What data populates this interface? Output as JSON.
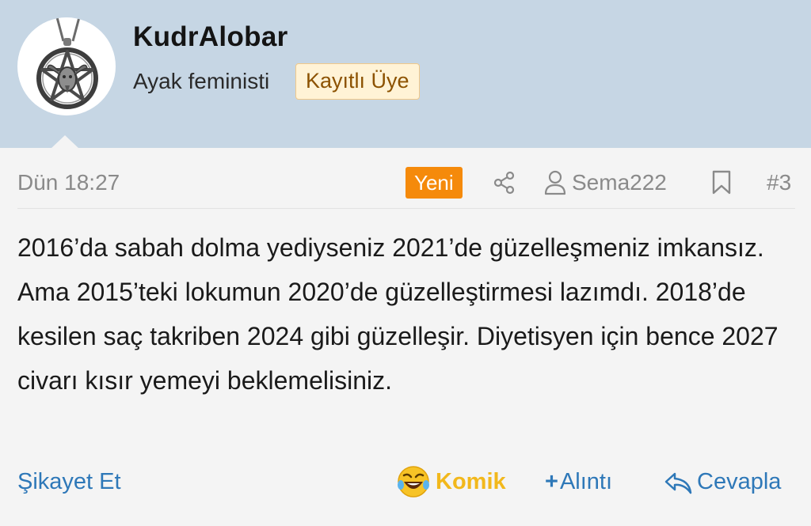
{
  "author": {
    "username": "KudrAlobar",
    "custom_title": "Ayak feministi",
    "role_badge": "Kayıtlı Üye"
  },
  "post": {
    "date": "Dün 18:27",
    "new_badge": "Yeni",
    "mentioned_user": "Sema222",
    "post_number": "#3",
    "body": "2016’da sabah dolma yediyseniz 2021’de güzelleşmeniz imkansız. Ama 2015’teki lokumun 2020’de güzelleştirmesi lazımdı. 2018’de kesilen saç takriben 2024 gibi güzelleşir. Diyetisyen için bence 2027 civarı kısır yemeyi beklemelisiniz."
  },
  "actions": {
    "report": "Şikayet Et",
    "reaction": "Komik",
    "quote": "Alıntı",
    "reply": "Cevapla"
  },
  "icons": {
    "avatar": "pentagram-pendant-avatar",
    "share": "share-icon",
    "user": "user-icon",
    "bookmark": "bookmark-icon",
    "reaction": "laughing-emoji-icon",
    "plus": "plus-icon",
    "reply": "reply-arrow-icon"
  },
  "colors": {
    "header_bg": "#c6d6e4",
    "link": "#2e78b8",
    "new_badge": "#f58a0b",
    "reaction": "#f2b81c",
    "role_badge_bg": "#fff3d6"
  }
}
